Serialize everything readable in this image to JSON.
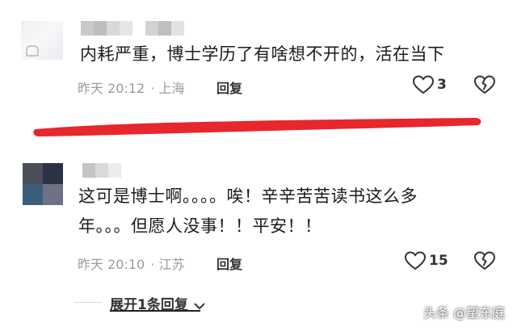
{
  "comments": [
    {
      "text": "内耗严重，博士学历了有啥想不开的，活在当下",
      "time": "昨天 20:12",
      "location": "上海",
      "reply_label": "回复",
      "likes": "3"
    },
    {
      "text_line1": "这可是博士啊。。。。唉！辛辛苦苦读书这么多",
      "text_line2": "年。。。但愿人没事！！平安！！",
      "time": "昨天 20:10",
      "location": "江苏",
      "reply_label": "回复",
      "likes": "15"
    }
  ],
  "expand_label": "展开1条回复",
  "watermark": "头条 @望东庭",
  "colors": {
    "annotation_red": "#e8262d",
    "meta_gray": "#9b9b9b"
  },
  "icons": [
    "heart-outline-icon",
    "broken-heart-icon",
    "chevron-down-icon"
  ]
}
